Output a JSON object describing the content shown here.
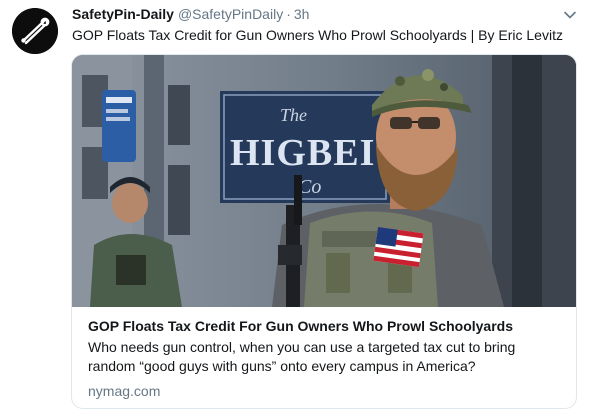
{
  "tweet": {
    "display_name": "SafetyPin-Daily",
    "handle": "@SafetyPinDaily",
    "separator": "·",
    "time": "3h",
    "text": "GOP Floats Tax Credit for Gun Owners Who Prowl Schoolyards | By Eric Levitz"
  },
  "card": {
    "image_sign_top": "The",
    "image_sign_main": "HIGBEI",
    "image_sign_sub": "Co",
    "title": "GOP Floats Tax Credit For Gun Owners Who Prowl Schoolyards",
    "description_line1": "Who needs gun control, when you can use a targeted tax cut to bring",
    "description_line2": "random “good guys with guns” onto every campus in America?",
    "domain": "nymag.com"
  },
  "icons": {
    "avatar": "safety-pin-icon",
    "caret": "chevron-down-icon"
  },
  "colors": {
    "secondary_text": "#657786",
    "primary_text": "#14171a",
    "card_border": "#e1e8ed"
  }
}
